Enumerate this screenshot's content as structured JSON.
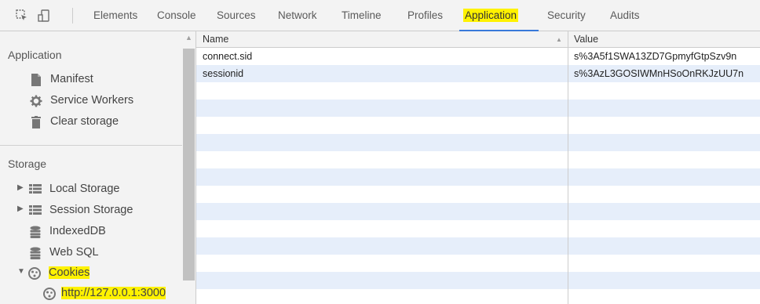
{
  "toolbar": {
    "tabs": [
      {
        "label": "Elements"
      },
      {
        "label": "Console"
      },
      {
        "label": "Sources"
      },
      {
        "label": "Network"
      },
      {
        "label": "Timeline"
      },
      {
        "label": "Profiles"
      },
      {
        "label": "Application"
      },
      {
        "label": "Security"
      },
      {
        "label": "Audits"
      }
    ],
    "active_tab": "Application"
  },
  "sidebar": {
    "application": {
      "title": "Application",
      "items": [
        {
          "label": "Manifest",
          "icon": "manifest-icon"
        },
        {
          "label": "Service Workers",
          "icon": "gear-icon"
        },
        {
          "label": "Clear storage",
          "icon": "trash-icon"
        }
      ]
    },
    "storage": {
      "title": "Storage",
      "items": [
        {
          "label": "Local Storage",
          "icon": "grid-icon"
        },
        {
          "label": "Session Storage",
          "icon": "grid-icon"
        },
        {
          "label": "IndexedDB",
          "icon": "database-icon"
        },
        {
          "label": "Web SQL",
          "icon": "database-icon"
        },
        {
          "label": "Cookies",
          "icon": "cookie-icon"
        },
        {
          "label": "http://127.0.0.1:3000",
          "icon": "cookie-icon"
        }
      ]
    }
  },
  "table": {
    "columns": {
      "name": "Name",
      "value": "Value"
    },
    "rows": [
      {
        "name": "connect.sid",
        "value": "s%3A5f1SWA13ZD7GpmyfGtpSzv9n"
      },
      {
        "name": "sessionid",
        "value": "s%3AzL3GOSIWMnHSoOnRKJzUU7n"
      }
    ]
  },
  "colors": {
    "highlight": "#fff200",
    "accent": "#3879d9",
    "row_stripe": "#e6eefa"
  }
}
